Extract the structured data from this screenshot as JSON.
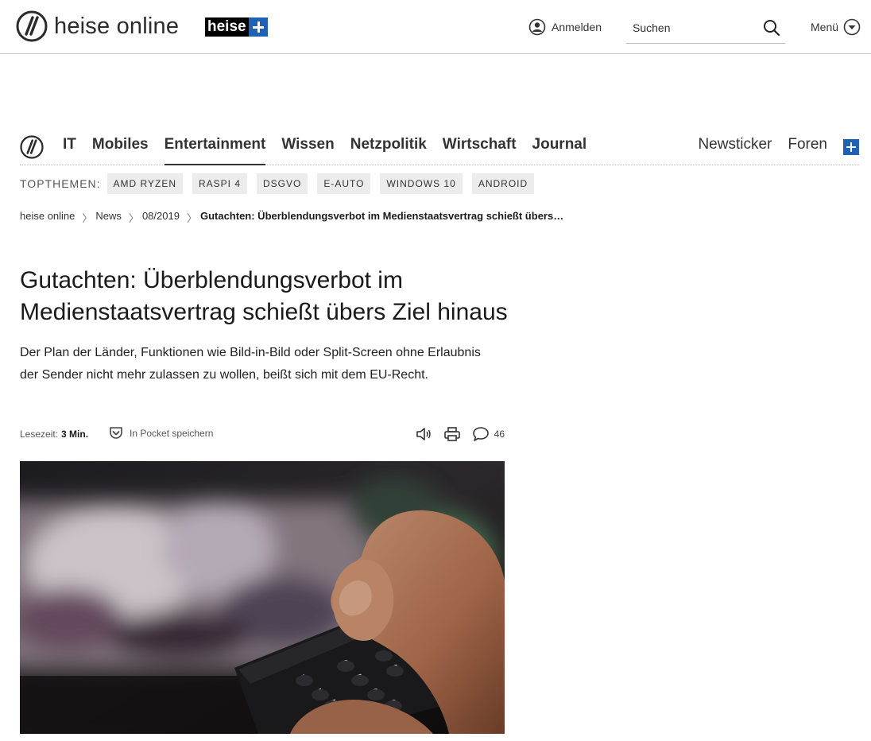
{
  "header": {
    "brand": "heise online",
    "plus_badge": "heise",
    "login_label": "Anmelden",
    "search_placeholder": "Suchen",
    "menu_label": "Menü"
  },
  "nav": {
    "items": [
      "IT",
      "Mobiles",
      "Entertainment",
      "Wissen",
      "Netzpolitik",
      "Wirtschaft",
      "Journal"
    ],
    "active": "Entertainment",
    "right": [
      "Newsticker",
      "Foren"
    ]
  },
  "topics": {
    "label": "TOPTHEMEN:",
    "tags": [
      "AMD RYZEN",
      "RASPI 4",
      "DSGVO",
      "E-AUTO",
      "WINDOWS 10",
      "ANDROID"
    ]
  },
  "breadcrumb": {
    "items": [
      "heise online",
      "News",
      "08/2019"
    ],
    "current": "Gutachten: Überblendungsverbot im Medienstaatsvertrag schießt übers…"
  },
  "article": {
    "headline": "Gutachten: Überblendungsverbot im Medienstaatsvertrag schießt übers Ziel hinaus",
    "lead": "Der Plan der Länder, Funktionen wie Bild-in-Bild oder Split-Screen ohne Erlaubnis der Sender nicht mehr zulassen zu wollen, beißt sich mit dem EU-Recht.",
    "readtime_label": "Lesezeit:",
    "readtime_value": "3 Min.",
    "pocket_label": "In Pocket speichern",
    "comment_count": "46"
  },
  "colors": {
    "accent": "#1f62b5",
    "text": "#1a1a1a"
  },
  "icons": [
    "heise-logo-icon",
    "user-icon",
    "search-icon",
    "chevron-down-icon",
    "pocket-icon",
    "speaker-icon",
    "print-icon",
    "comment-icon"
  ]
}
